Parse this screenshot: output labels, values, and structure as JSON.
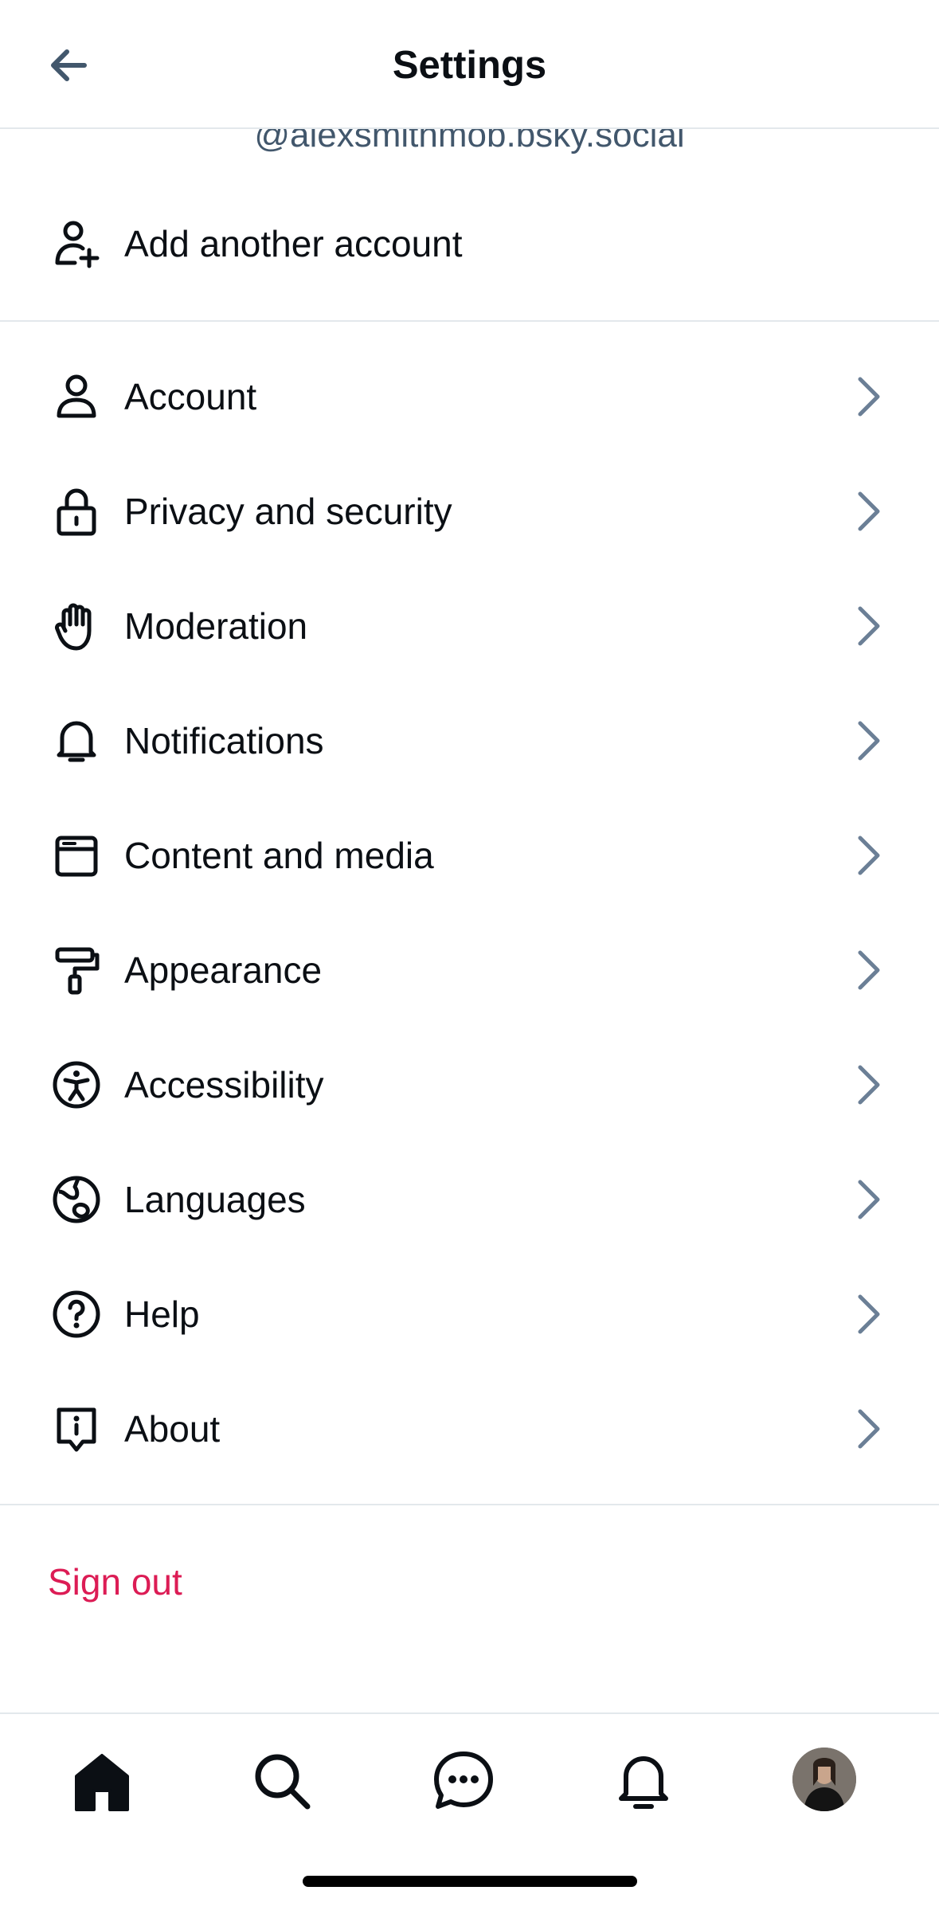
{
  "header": {
    "title": "Settings",
    "back_icon": "arrow-left-icon"
  },
  "account": {
    "handle": "@alexsmithmob.bsky.social",
    "add_account_label": "Add another account",
    "add_account_icon": "person-plus-icon"
  },
  "menu": {
    "items": [
      {
        "label": "Account",
        "icon": "person-icon"
      },
      {
        "label": "Privacy and security",
        "icon": "lock-icon"
      },
      {
        "label": "Moderation",
        "icon": "hand-icon"
      },
      {
        "label": "Notifications",
        "icon": "bell-icon"
      },
      {
        "label": "Content and media",
        "icon": "window-icon"
      },
      {
        "label": "Appearance",
        "icon": "paint-roller-icon"
      },
      {
        "label": "Accessibility",
        "icon": "accessibility-icon"
      },
      {
        "label": "Languages",
        "icon": "globe-icon"
      },
      {
        "label": "Help",
        "icon": "question-circle-icon"
      },
      {
        "label": "About",
        "icon": "info-bubble-icon"
      }
    ]
  },
  "signout": {
    "label": "Sign out"
  },
  "tabbar": {
    "tabs": [
      {
        "name": "home",
        "icon": "home-icon"
      },
      {
        "name": "search",
        "icon": "search-icon"
      },
      {
        "name": "chat",
        "icon": "chat-icon"
      },
      {
        "name": "notifications",
        "icon": "bell-icon"
      },
      {
        "name": "profile",
        "icon": "avatar"
      }
    ]
  },
  "colors": {
    "text": "#0b0f14",
    "muted": "#42576c",
    "chevron": "#6b7f96",
    "divider": "#e3e8ec",
    "danger": "#dc1c55"
  }
}
